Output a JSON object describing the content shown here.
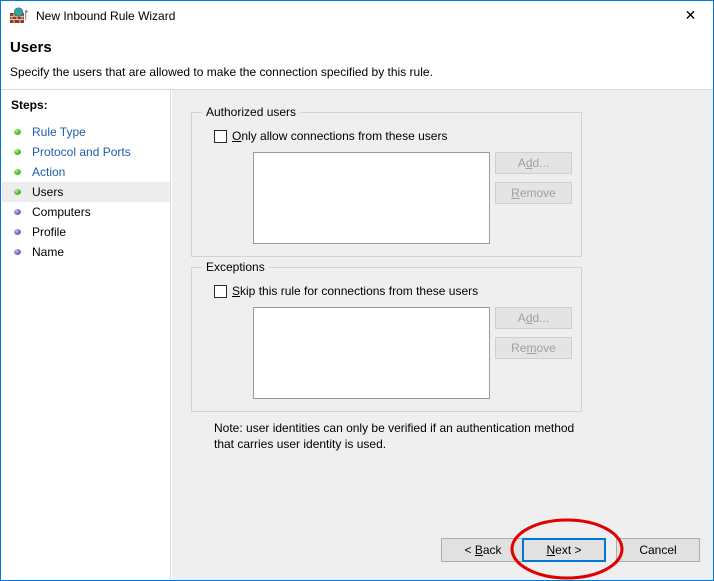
{
  "window": {
    "title": "New Inbound Rule Wizard",
    "icon": "firewall-globe-icon",
    "close_label": "✕",
    "border_color": "#0078d7"
  },
  "header": {
    "title": "Users",
    "subtitle": "Specify the users that are allowed to make the connection specified by this rule."
  },
  "sidebar": {
    "heading": "Steps:",
    "items": [
      {
        "label": "Rule Type",
        "state": "done",
        "bullet": "green-bullet-icon",
        "link": true
      },
      {
        "label": "Protocol and Ports",
        "state": "done",
        "bullet": "green-bullet-icon",
        "link": true
      },
      {
        "label": "Action",
        "state": "done",
        "bullet": "green-bullet-icon",
        "link": true
      },
      {
        "label": "Users",
        "state": "current",
        "bullet": "green-bullet-icon",
        "link": false
      },
      {
        "label": "Computers",
        "state": "todo",
        "bullet": "purple-bullet-icon",
        "link": false
      },
      {
        "label": "Profile",
        "state": "todo",
        "bullet": "purple-bullet-icon",
        "link": false
      },
      {
        "label": "Name",
        "state": "todo",
        "bullet": "purple-bullet-icon",
        "link": false
      }
    ]
  },
  "main": {
    "authorized_users": {
      "group_title": "Authorized users",
      "checkbox_label_pre": "",
      "checkbox_accel": "O",
      "checkbox_label_post": "nly allow connections from these users",
      "checked": false,
      "list_items": [],
      "add_label_pre": "A",
      "add_accel": "d",
      "add_label_post": "d...",
      "add_enabled": false,
      "remove_label_pre": "",
      "remove_accel": "R",
      "remove_label_post": "emove",
      "remove_enabled": false
    },
    "exceptions": {
      "group_title": "Exceptions",
      "checkbox_label_pre": "",
      "checkbox_accel": "S",
      "checkbox_label_post": "kip this rule for connections from these users",
      "checked": false,
      "list_items": [],
      "add_label_pre": "A",
      "add_accel": "d",
      "add_label_post": "d...",
      "add_enabled": false,
      "remove_label_pre": "Re",
      "remove_accel": "m",
      "remove_label_post": "ove",
      "remove_enabled": false
    },
    "note": "Note: user identities can only be verified if an authentication method that carries user identity is used."
  },
  "buttons": {
    "back_pre": "< ",
    "back_accel": "B",
    "back_post": "ack",
    "next_pre": "",
    "next_accel": "N",
    "next_post": "ext >",
    "cancel": "Cancel",
    "default_button": "next"
  },
  "annotation": {
    "shape": "ellipse",
    "color": "#e00000",
    "target": "next-button"
  }
}
